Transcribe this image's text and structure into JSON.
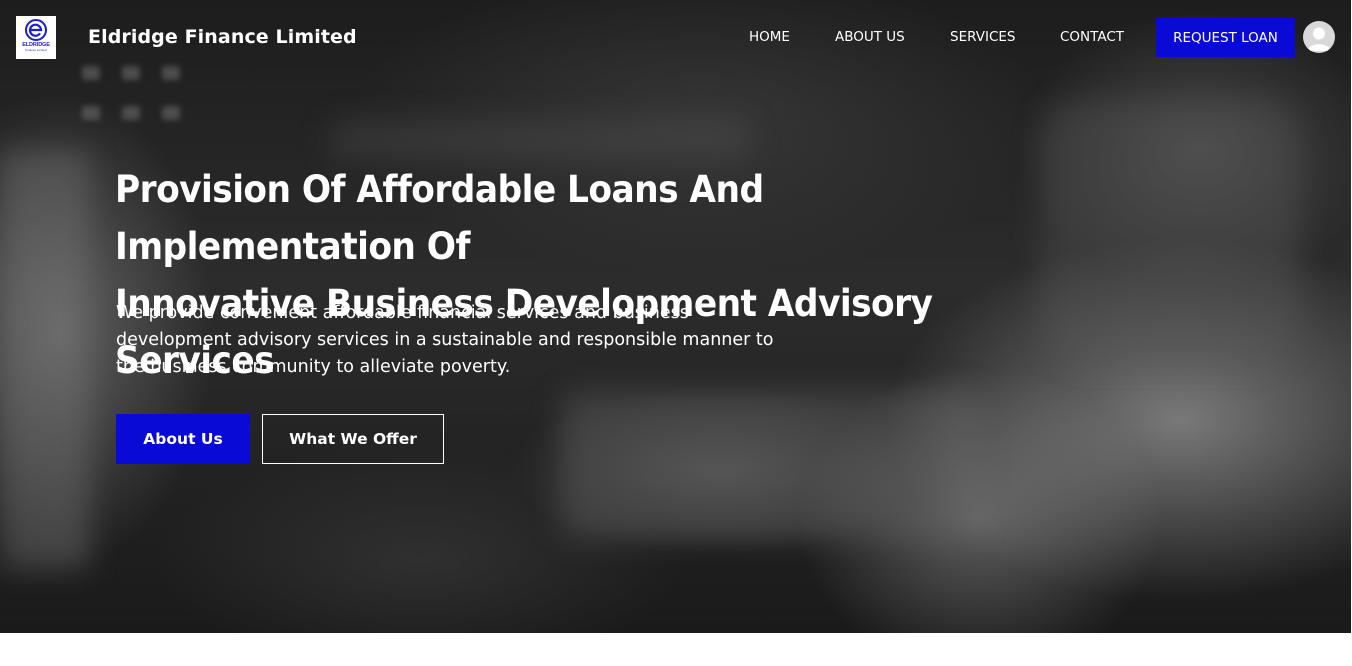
{
  "header": {
    "logo": {
      "wordmark": "ELDRIDGE",
      "sub": "Finance Limited",
      "icon": "eldridge-e-logo-icon",
      "color": "#1a1fd0"
    },
    "brand_name": "Eldridge Finance Limited",
    "nav": [
      {
        "label": "HOME"
      },
      {
        "label": "ABOUT US"
      },
      {
        "label": "SERVICES"
      },
      {
        "label": "CONTACT"
      }
    ],
    "request_loan_label": "REQUEST LOAN",
    "avatar_icon": "user-avatar-icon"
  },
  "hero": {
    "headline_line1": "Provision Of Affordable Loans And Implementation Of",
    "headline_line2": "Innovative Business Development Advisory Services",
    "subtext_line1": "We provide convenient affordable financial services and business",
    "subtext_line2": "development advisory services in a sustainable and responsible manner to",
    "subtext_line3": "the business community to alleviate poverty.",
    "primary_button": "About Us",
    "secondary_button": "What We Offer"
  },
  "colors": {
    "accent": "#0a0ad6",
    "text_on_dark": "#ffffff",
    "background": "#ffffff"
  }
}
